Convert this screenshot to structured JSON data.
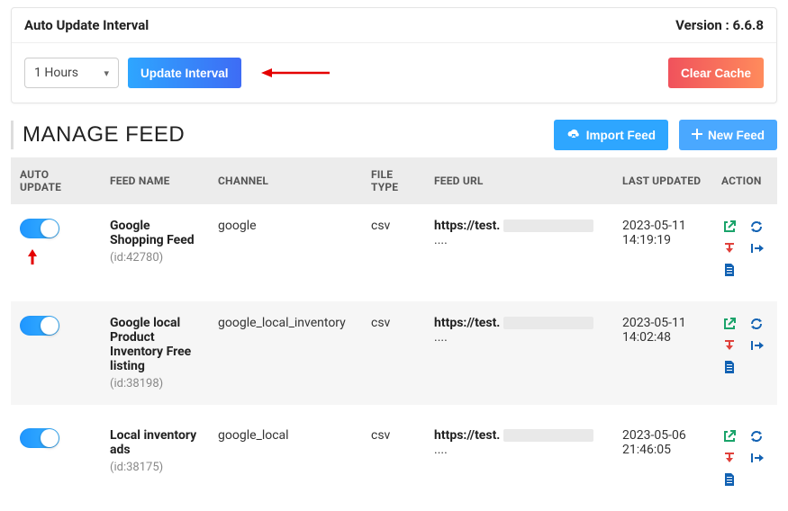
{
  "card": {
    "title": "Auto Update Interval",
    "version_label": "Version : 6.6.8",
    "interval_value": "1 Hours",
    "update_btn": "Update Interval",
    "clear_btn": "Clear Cache"
  },
  "section": {
    "title": "MANAGE FEED",
    "import_btn": "Import Feed",
    "new_btn": "New Feed"
  },
  "columns": {
    "auto": "AUTO UPDATE",
    "feed": "FEED NAME",
    "channel": "CHANNEL",
    "ftype": "FILE TYPE",
    "url": "FEED URL",
    "last": "LAST UPDATED",
    "action": "ACTION"
  },
  "rows": [
    {
      "name": "Google Shopping Feed",
      "id": "(id:42780)",
      "channel": "google",
      "ftype": "csv",
      "url_prefix": "https://test.",
      "url_suffix": "....",
      "last1": "2023-05-11",
      "last2": "14:19:19"
    },
    {
      "name": "Google local Product Inventory Free listing",
      "id": "(id:38198)",
      "channel": "google_local_inventory",
      "ftype": "csv",
      "url_prefix": "https://test.",
      "url_suffix": "....",
      "last1": "2023-05-11",
      "last2": "14:02:48"
    },
    {
      "name": "Local inventory ads",
      "id": "(id:38175)",
      "channel": "google_local",
      "ftype": "csv",
      "url_prefix": "https://test.",
      "url_suffix": "....",
      "last1": "2023-05-06",
      "last2": "21:46:05"
    }
  ]
}
